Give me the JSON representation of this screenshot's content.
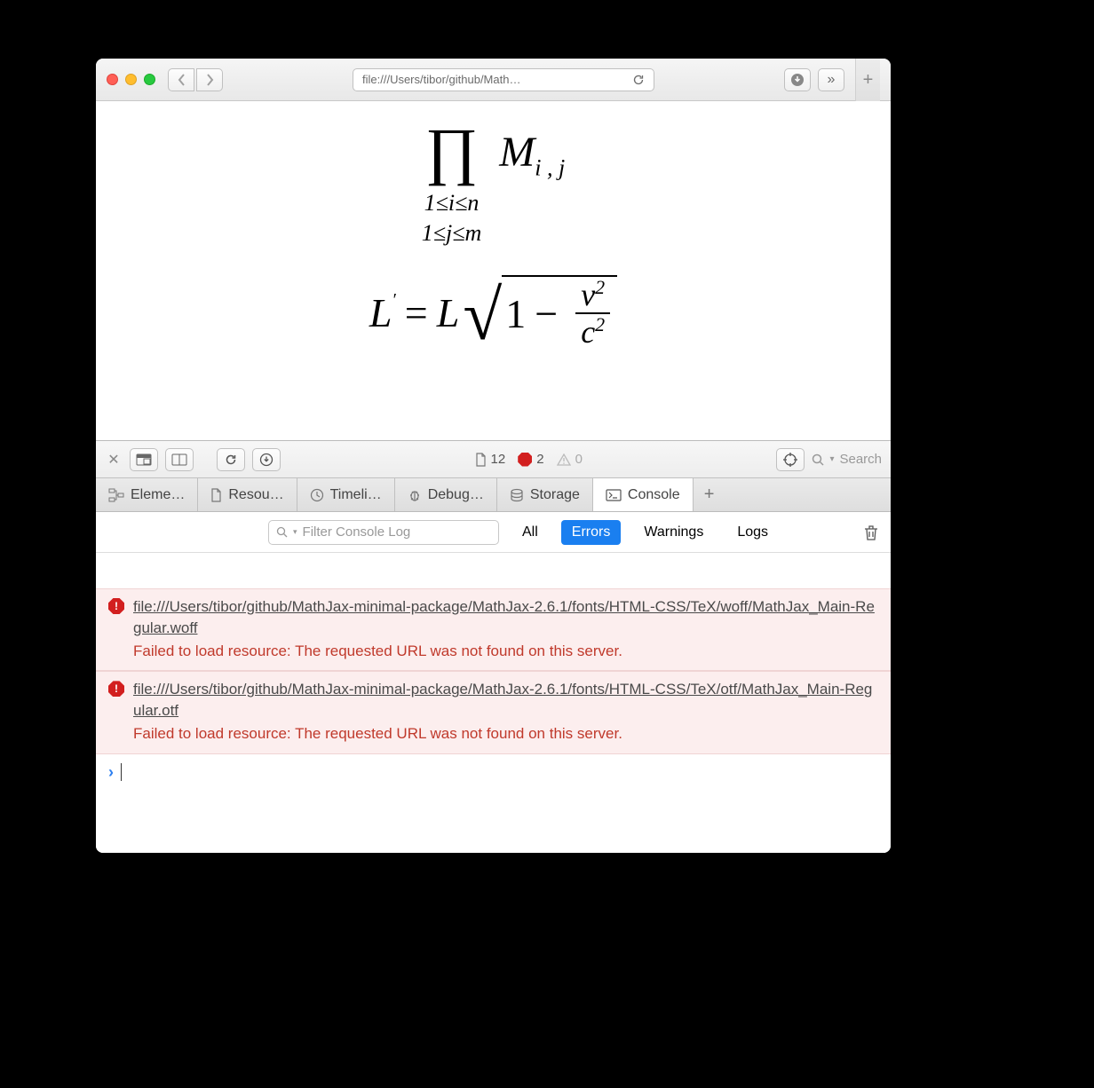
{
  "titlebar": {
    "url": "file:///Users/tibor/github/Math…"
  },
  "page": {
    "formula1": {
      "operator": "∏",
      "subscript_line1": "1≤i≤n",
      "subscript_line2": "1≤j≤m",
      "term_base": "M",
      "term_sub": "i , j"
    },
    "formula2": {
      "lhs": "L",
      "prime": "′",
      "eq": "=",
      "rhs_L": "L",
      "one": "1",
      "minus": "−",
      "num": "v",
      "num_sup": "2",
      "den": "c",
      "den_sup": "2"
    }
  },
  "devtools": {
    "counts": {
      "resources": "12",
      "errors": "2",
      "warnings": "0"
    },
    "search_placeholder": "Search",
    "tabs": {
      "elements": "Eleme…",
      "resources": "Resou…",
      "timelines": "Timeli…",
      "debugger": "Debug…",
      "storage": "Storage",
      "console": "Console"
    },
    "filter": {
      "placeholder": "Filter Console Log",
      "all": "All",
      "errors": "Errors",
      "warnings": "Warnings",
      "logs": "Logs"
    },
    "errors": [
      {
        "url": "file:///Users/tibor/github/MathJax-minimal-package/MathJax-2.6.1/fonts/HTML-CSS/TeX/woff/MathJax_Main-Regular.woff",
        "message": "Failed to load resource: The requested URL was not found on this server."
      },
      {
        "url": "file:///Users/tibor/github/MathJax-minimal-package/MathJax-2.6.1/fonts/HTML-CSS/TeX/otf/MathJax_Main-Regular.otf",
        "message": "Failed to load resource: The requested URL was not found on this server."
      }
    ]
  }
}
